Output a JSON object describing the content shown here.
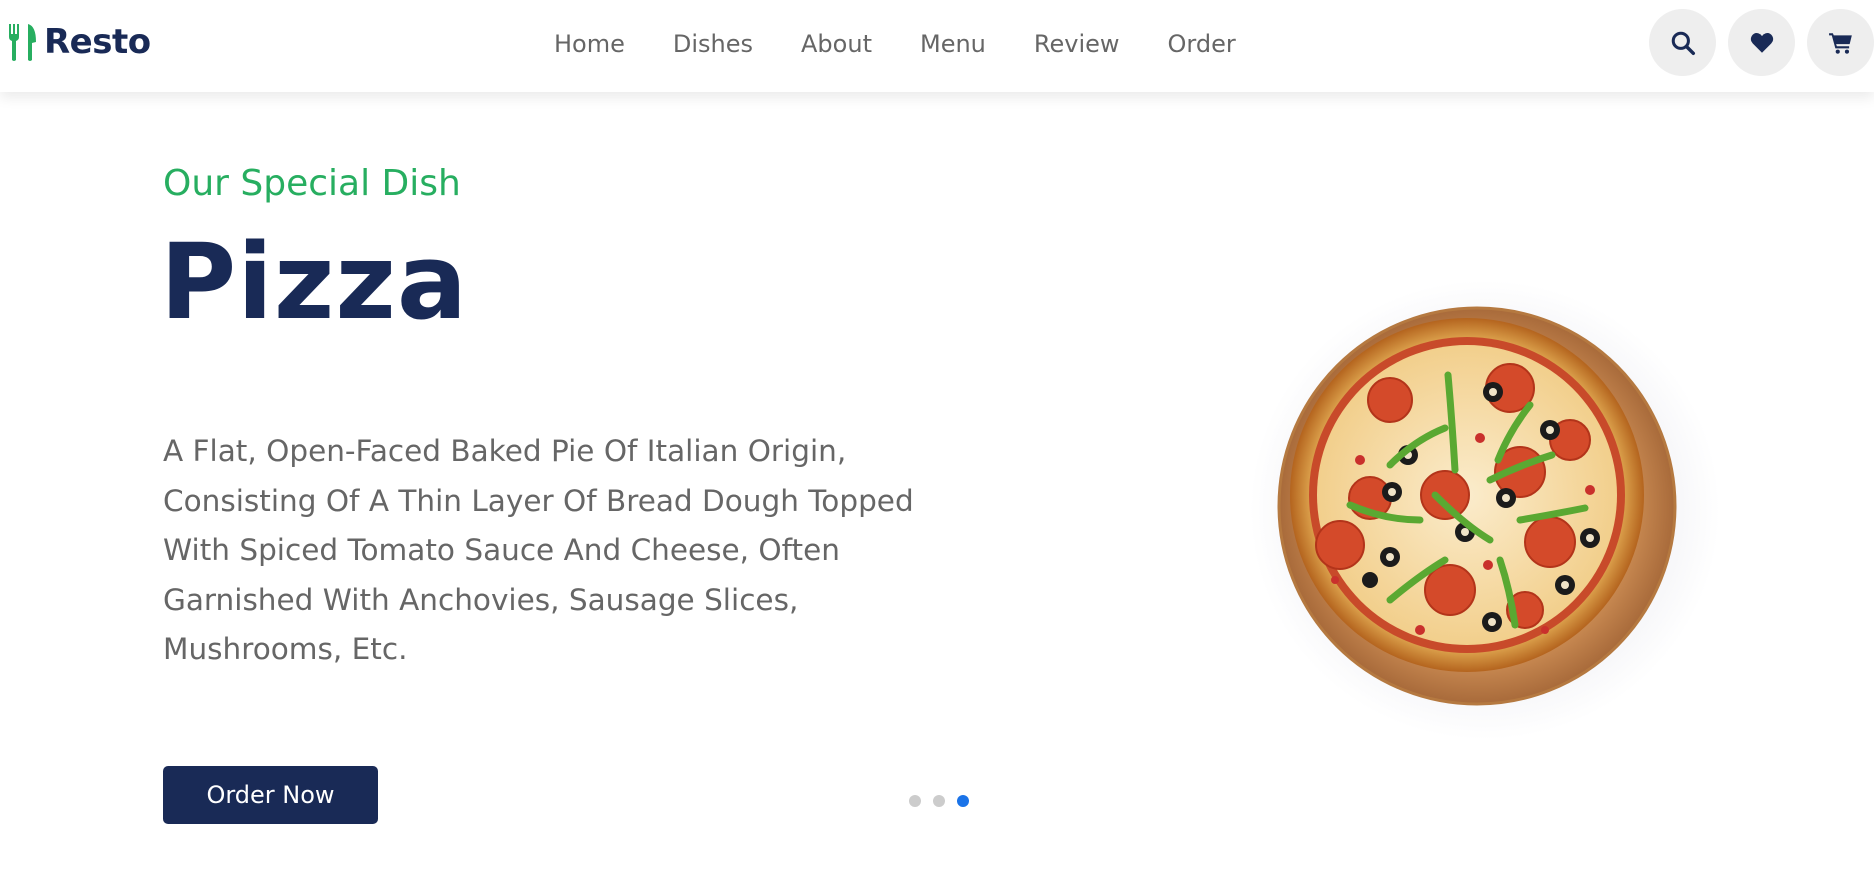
{
  "brand": {
    "logo_icon": "utensils-icon",
    "name": "Resto",
    "accent_color": "#27ae60",
    "primary_color": "#192a56"
  },
  "nav": {
    "items": [
      {
        "label": "Home"
      },
      {
        "label": "Dishes"
      },
      {
        "label": "About"
      },
      {
        "label": "Menu"
      },
      {
        "label": "Review"
      },
      {
        "label": "Order"
      }
    ]
  },
  "header_icons": [
    "search-icon",
    "heart-icon",
    "cart-icon"
  ],
  "hero": {
    "subtitle": "Our Special Dish",
    "title": "Pizza",
    "description": "A Flat, Open-Faced Baked Pie Of Italian Origin, Consisting Of A Thin Layer Of Bread Dough Topped With Spiced Tomato Sauce And Cheese, Often Garnished With Anchovies, Sausage Slices, Mushrooms, Etc.",
    "button_label": "Order Now",
    "image": "pizza-image"
  },
  "slider": {
    "slide_count": 3,
    "active_slide": 3,
    "active_color": "#1a73e8"
  }
}
